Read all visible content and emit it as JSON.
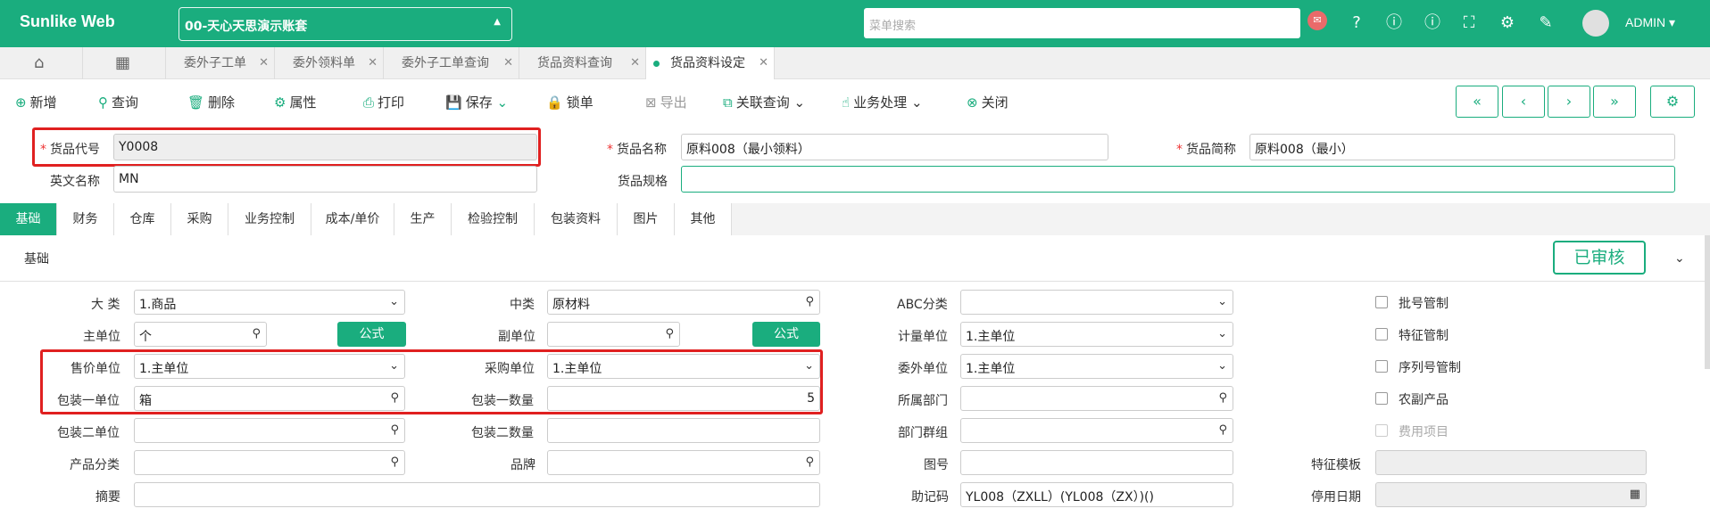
{
  "app": {
    "title": "Sunlike Web",
    "account": "00-天心天思演示账套",
    "search_placeholder": "菜单搜索",
    "user": "ADMIN"
  },
  "tabs": [
    {
      "label": "委外子工单"
    },
    {
      "label": "委外领料单"
    },
    {
      "label": "委外子工单查询"
    },
    {
      "label": "货品资料查询"
    },
    {
      "label": "货品资料设定"
    }
  ],
  "toolbar": {
    "add": "新增",
    "query": "查询",
    "delete": "删除",
    "attr": "属性",
    "print": "打印",
    "save": "保存",
    "lock": "锁单",
    "export": "导出",
    "link_query": "关联查询",
    "biz": "业务处理",
    "close": "关闭"
  },
  "header": {
    "code_label": "货品代号",
    "code": "Y0008",
    "name_label": "货品名称",
    "name": "原料008（最小领料）",
    "short_label": "货品简称",
    "short": "原料008（最小）",
    "en_label": "英文名称",
    "en": "MN",
    "spec_label": "货品规格",
    "spec": ""
  },
  "subtabs": [
    "基础",
    "财务",
    "仓库",
    "采购",
    "业务控制",
    "成本/单价",
    "生产",
    "检验控制",
    "包装资料",
    "图片",
    "其他"
  ],
  "section": {
    "title": "基础",
    "status": "已审核"
  },
  "form": {
    "big_label": "大 类",
    "big": "1.商品",
    "mid_label": "中类",
    "mid": "原材料",
    "abc_label": "ABC分类",
    "abc": "",
    "unit_label": "主单位",
    "unit": "个",
    "formula": "公式",
    "sub_unit_label": "副单位",
    "sub_unit": "",
    "formula2": "公式",
    "calc_label": "计量单位",
    "calc": "1.主单位",
    "sale_label": "售价单位",
    "sale": "1.主单位",
    "buy_label": "采购单位",
    "buy": "1.主单位",
    "outs_label": "委外单位",
    "outs": "1.主单位",
    "pk1_label": "包装一单位",
    "pk1": "箱",
    "pk1q_label": "包装一数量",
    "pk1q": "5",
    "dept_label": "所属部门",
    "dept": "",
    "pk2_label": "包装二单位",
    "pk2": "",
    "pk2q_label": "包装二数量",
    "pk2q": "",
    "grp_label": "部门群组",
    "grp": "",
    "cat_label": "产品分类",
    "cat": "",
    "brand_label": "品牌",
    "brand": "",
    "fig_label": "图号",
    "fig": "",
    "feat_label": "特征模板",
    "feat": "",
    "memo_label": "摘要",
    "memo": "",
    "mnem_label": "助记码",
    "mnem": "YL008（ZXLL）(YL008（ZX）)()",
    "stop_label": "停用日期",
    "stop": ""
  },
  "checks": {
    "batch": "批号管制",
    "feature": "特征管制",
    "serial": "序列号管制",
    "agri": "农副产品",
    "fee": "费用项目"
  }
}
